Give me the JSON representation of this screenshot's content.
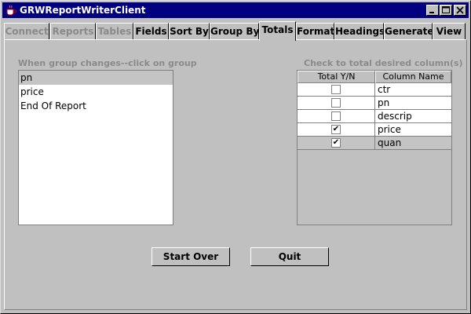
{
  "window": {
    "title": "GRWReportWriterClient"
  },
  "tabs": [
    {
      "label": "Connect",
      "state": "disabled"
    },
    {
      "label": "Reports",
      "state": "disabled"
    },
    {
      "label": "Tables",
      "state": "disabled"
    },
    {
      "label": "Fields",
      "state": "enabled"
    },
    {
      "label": "Sort By",
      "state": "enabled"
    },
    {
      "label": "Group By",
      "state": "enabled"
    },
    {
      "label": "Totals",
      "state": "selected"
    },
    {
      "label": "Format",
      "state": "enabled"
    },
    {
      "label": "Headings",
      "state": "enabled"
    },
    {
      "label": "Generate",
      "state": "enabled"
    },
    {
      "label": "View",
      "state": "enabled"
    }
  ],
  "group_section": {
    "label": "When group changes--click on group",
    "items": [
      {
        "text": "pn",
        "selected": true
      },
      {
        "text": "price",
        "selected": false
      },
      {
        "text": "End Of Report",
        "selected": false
      }
    ]
  },
  "totals_section": {
    "label": "Check to total desired column(s)",
    "headers": [
      "Total Y/N",
      "Column Name"
    ],
    "rows": [
      {
        "name": "ctr",
        "checked": false,
        "selected": false
      },
      {
        "name": "pn",
        "checked": false,
        "selected": false
      },
      {
        "name": "descrip",
        "checked": false,
        "selected": false
      },
      {
        "name": "price",
        "checked": true,
        "selected": false
      },
      {
        "name": "quan",
        "checked": true,
        "selected": true
      }
    ],
    "check_mark": "✔"
  },
  "buttons": {
    "start_over": "Start Over",
    "quit": "Quit"
  },
  "colors": {
    "title_bar": "#000080",
    "face": "#c0c0c0",
    "disabled_text": "#8a8a8a",
    "selection": "#c4c4c4"
  }
}
